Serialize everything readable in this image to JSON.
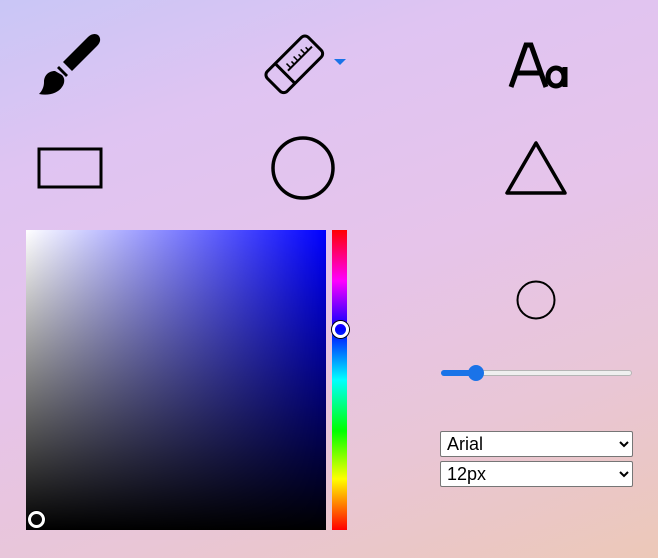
{
  "toolbar": {
    "tools": [
      {
        "id": "brush",
        "icon": "paintbrush-icon",
        "selected": true
      },
      {
        "id": "eraser",
        "icon": "eraser-icon",
        "has_dropdown": true
      },
      {
        "id": "text",
        "icon": "text-icon",
        "glyph": "Aa"
      },
      {
        "id": "rectangle",
        "icon": "rectangle-icon"
      },
      {
        "id": "circle",
        "icon": "circle-icon"
      },
      {
        "id": "triangle",
        "icon": "triangle-icon"
      }
    ],
    "dropdown_caret_color": "#1a73e8"
  },
  "color_picker": {
    "hue_color": "#0000ff",
    "selected_color": "#000000",
    "hue_position": 0.33,
    "saturation": 0,
    "value": 0
  },
  "brush_size": {
    "slider_fraction": 0.16
  },
  "text_options": {
    "font_family": {
      "selected": "Arial",
      "options": [
        "Arial"
      ]
    },
    "font_size": {
      "selected": "12px",
      "options": [
        "12px"
      ]
    }
  },
  "colors": {
    "accent": "#1a73e8",
    "icon_stroke": "#000000"
  }
}
